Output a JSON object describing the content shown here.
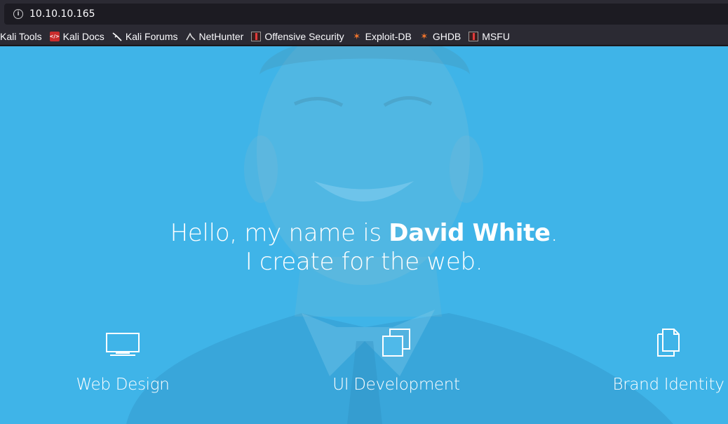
{
  "browser": {
    "url": "10.10.10.165",
    "bookmarks": [
      {
        "label": "Kali Tools",
        "icon": "kali-tools-icon"
      },
      {
        "label": "Kali Docs",
        "icon": "kali-docs-icon"
      },
      {
        "label": "Kali Forums",
        "icon": "kali-forums-icon"
      },
      {
        "label": "NetHunter",
        "icon": "nethunter-icon"
      },
      {
        "label": "Offensive Security",
        "icon": "offensive-security-icon"
      },
      {
        "label": "Exploit-DB",
        "icon": "exploit-db-icon"
      },
      {
        "label": "GHDB",
        "icon": "ghdb-icon"
      },
      {
        "label": "MSFU",
        "icon": "msfu-icon"
      }
    ]
  },
  "hero": {
    "greeting_prefix": "Hello, my name is ",
    "name": "David White",
    "greeting_suffix": ".",
    "tagline": "I create for the web.",
    "accent_color": "#46b6e8"
  },
  "services": [
    {
      "label": "Web Design",
      "icon": "monitor-icon"
    },
    {
      "label": "UI Development",
      "icon": "stacked-windows-icon"
    },
    {
      "label": "Brand Identity",
      "icon": "documents-icon"
    }
  ]
}
